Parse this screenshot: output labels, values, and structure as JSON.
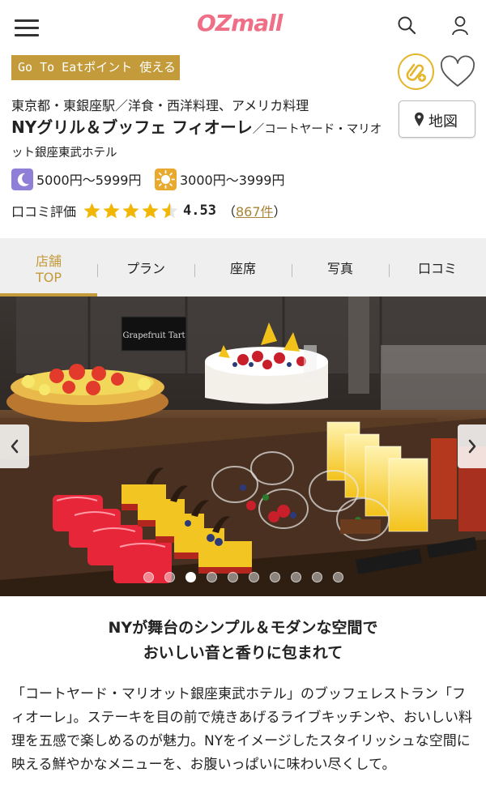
{
  "header": {
    "logo": "OZmall",
    "menu_icon": "hamburger-menu-icon",
    "search_icon": "search-icon",
    "account_icon": "user-icon"
  },
  "badge": {
    "label": "Go To Eatポイント 使える"
  },
  "restaurant": {
    "category": "東京都・東銀座駅／洋食・西洋料理、アメリカ料理",
    "name": "NYグリル＆ブッフェ フィオーレ",
    "subname": "／コートヤード・マリオット銀座東武ホテル"
  },
  "actions": {
    "coupon_icon": "coupon-clip-icon",
    "favorite_icon": "heart-icon",
    "map_label": "地図"
  },
  "prices": {
    "dinner": {
      "icon": "moon-icon",
      "text": "5000円～5999円",
      "color": "#8f7fd6"
    },
    "lunch": {
      "icon": "sun-icon",
      "text": "3000円～3999円",
      "color": "#e8a92f"
    }
  },
  "rating": {
    "label": "口コミ評価",
    "score": "4.53",
    "score_value": 4.53,
    "max_stars": 5,
    "reviews_open": "（",
    "reviews_link": "867件",
    "reviews_close": "）"
  },
  "tabs": [
    {
      "label_line1": "店舗",
      "label_line2": "TOP",
      "active": true
    },
    {
      "label_line1": "プラン",
      "label_line2": ""
    },
    {
      "label_line1": "座席",
      "label_line2": ""
    },
    {
      "label_line1": "写真",
      "label_line2": ""
    },
    {
      "label_line1": "口コミ",
      "label_line2": ""
    }
  ],
  "gallery": {
    "image_label": "Grapefruit Tart",
    "slide_count": 10,
    "active_slide": 3,
    "prev_icon": "chevron-left-icon",
    "next_icon": "chevron-right-icon"
  },
  "intro": {
    "headline_line1": "NYが舞台のシンプル＆モダンな空間で",
    "headline_line2": "おいしい音と香りに包まれて",
    "body": "「コートヤード・マリオット銀座東武ホテル」のブッフェレストラン「フィオーレ」。ステーキを目の前で焼きあげるライブキッチンや、おいしい料理を五感で楽しめるのが魅力。NYをイメージしたスタイリッシュな空間に映える鮮やかなメニューを、お腹いっぱいに味わい尽くして。"
  },
  "colors": {
    "brand_pink": "#ee6f86",
    "gold": "#c49b3b",
    "star_yellow": "#f2b705",
    "link_gold": "#a8843a",
    "tab_bg": "#efefef"
  }
}
